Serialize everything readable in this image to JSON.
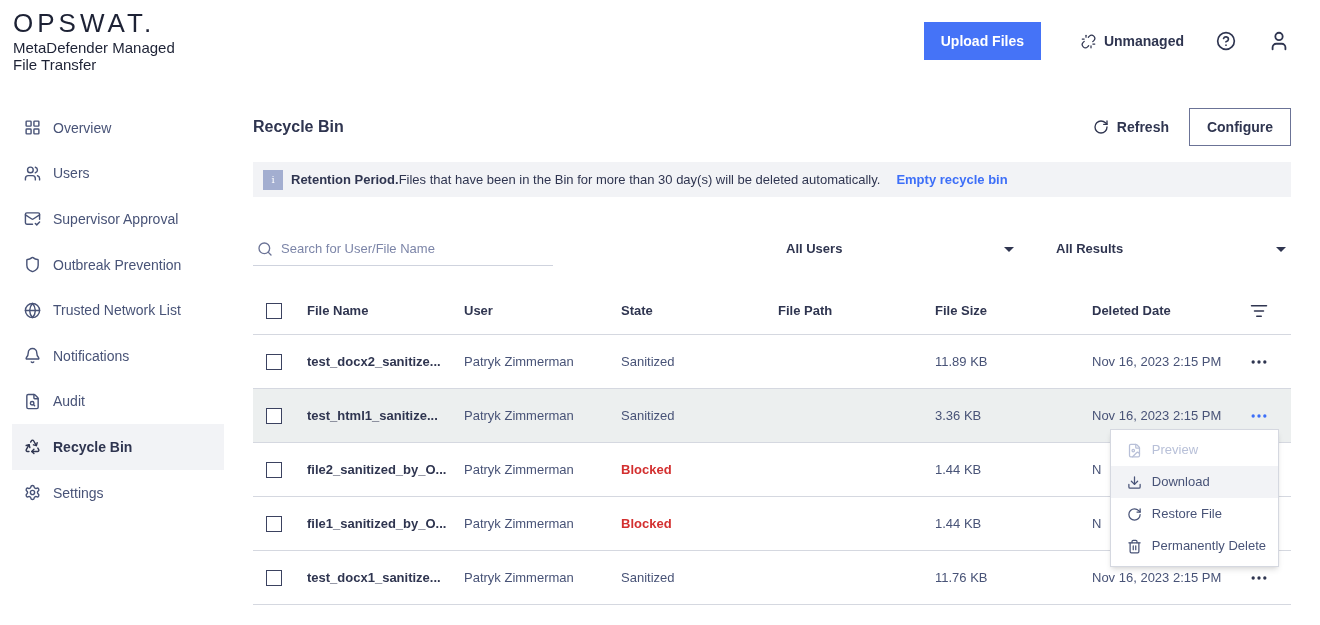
{
  "brand": {
    "logo": "OPSWAT.",
    "product": "MetaDefender Managed File Transfer"
  },
  "header": {
    "upload_button": "Upload Files",
    "unmanaged": "Unmanaged"
  },
  "sidebar": {
    "items": [
      {
        "label": "Overview",
        "selected": false
      },
      {
        "label": "Users",
        "selected": false
      },
      {
        "label": "Supervisor Approval",
        "selected": false
      },
      {
        "label": "Outbreak Prevention",
        "selected": false
      },
      {
        "label": "Trusted Network List",
        "selected": false
      },
      {
        "label": "Notifications",
        "selected": false
      },
      {
        "label": "Audit",
        "selected": false
      },
      {
        "label": "Recycle Bin",
        "selected": true
      },
      {
        "label": "Settings",
        "selected": false
      }
    ]
  },
  "page": {
    "title": "Recycle Bin",
    "refresh": "Refresh",
    "configure": "Configure"
  },
  "banner": {
    "icon_text": "i",
    "title": "Retention Period.",
    "message": "Files that have been in the Bin for more than 30 day(s) will be deleted automatically.",
    "link": "Empty recycle bin"
  },
  "filters": {
    "search": {
      "placeholder": "Search for User/File Name"
    },
    "users": "All Users",
    "results": "All Results"
  },
  "table": {
    "all_checked": false,
    "columns": [
      "File Name",
      "User",
      "State",
      "File Path",
      "File Size",
      "Deleted Date"
    ],
    "rows": [
      {
        "file_name": "test_docx2_sanitize...",
        "user": "Patryk Zimmerman",
        "state": "Sanitized",
        "kind": "sanitized",
        "size": "11.89 KB",
        "date": "Nov 16, 2023 2:15 PM",
        "checked": false,
        "selected": false
      },
      {
        "file_name": "test_html1_sanitize...",
        "user": "Patryk Zimmerman",
        "state": "Sanitized",
        "kind": "sanitized",
        "size": "3.36 KB",
        "date": "Nov 16, 2023 2:15 PM",
        "checked": false,
        "selected": true
      },
      {
        "file_name": "file2_sanitized_by_O...",
        "user": "Patryk Zimmerman",
        "state": "Blocked",
        "kind": "blocked",
        "size": "1.44 KB",
        "date": "N",
        "checked": false,
        "selected": false
      },
      {
        "file_name": "file1_sanitized_by_O...",
        "user": "Patryk Zimmerman",
        "state": "Blocked",
        "kind": "blocked",
        "size": "1.44 KB",
        "date": "N",
        "checked": false,
        "selected": false
      },
      {
        "file_name": "test_docx1_sanitize...",
        "user": "Patryk Zimmerman",
        "state": "Sanitized",
        "kind": "sanitized",
        "size": "11.76 KB",
        "date": "Nov 16, 2023 2:15 PM",
        "checked": false,
        "selected": false
      }
    ]
  },
  "context_menu": {
    "items": [
      {
        "label": "Preview",
        "disabled": true,
        "selected": false
      },
      {
        "label": "Download",
        "disabled": false,
        "selected": true
      },
      {
        "label": "Restore File",
        "disabled": false,
        "selected": false
      },
      {
        "label": "Permanently Delete",
        "disabled": false,
        "selected": false
      }
    ]
  }
}
